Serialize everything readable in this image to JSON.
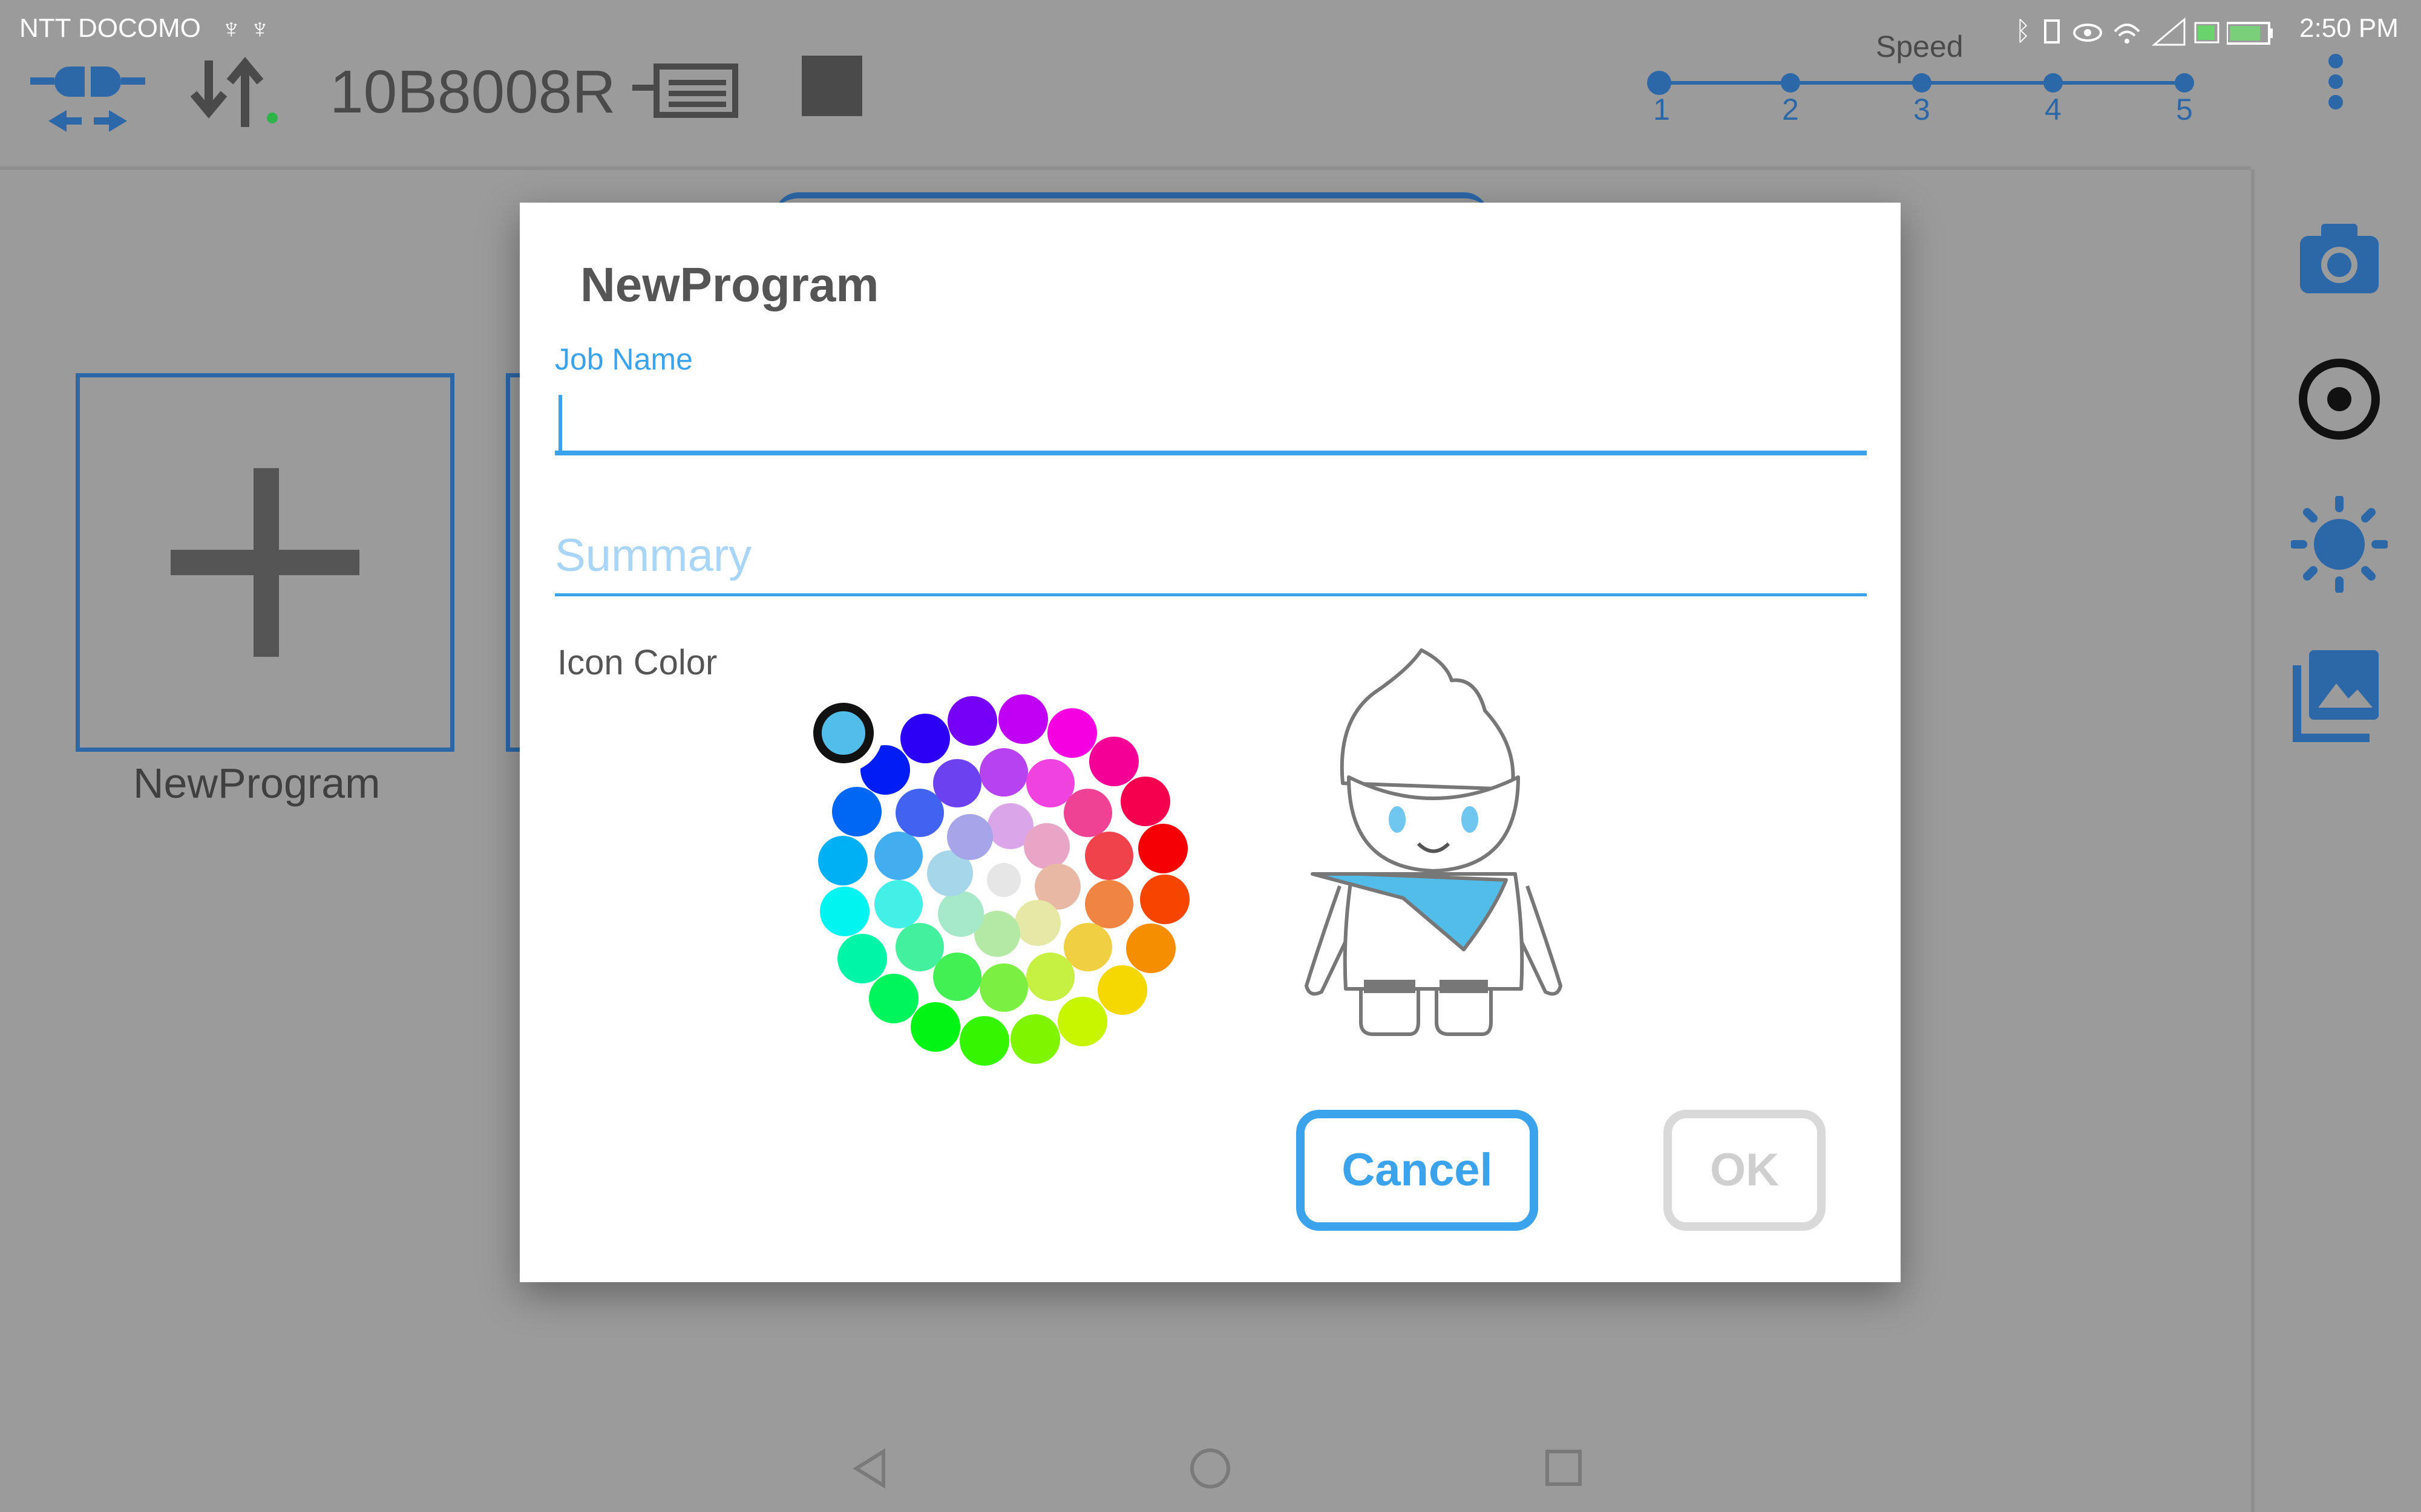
{
  "status_bar": {
    "carrier": "NTT DOCOMO",
    "time": "2:50 PM"
  },
  "toolbar": {
    "robot_id": "10B8008R",
    "speed": {
      "label": "Speed",
      "levels": [
        "1",
        "2",
        "3",
        "4",
        "5"
      ],
      "selected": "1"
    }
  },
  "background": {
    "program_tile_label": "NewProgram"
  },
  "dialog": {
    "title": "NewProgram",
    "job_name_label": "Job Name",
    "job_name_value": "",
    "summary_placeholder": "Summary",
    "icon_color_label": "Icon Color",
    "selected_color": "#52bde8",
    "cancel_label": "Cancel",
    "ok_label": "OK"
  },
  "colors": {
    "accent_blue": "#3aa3ec",
    "toolbar_icon_blue": "#2c67a8"
  }
}
